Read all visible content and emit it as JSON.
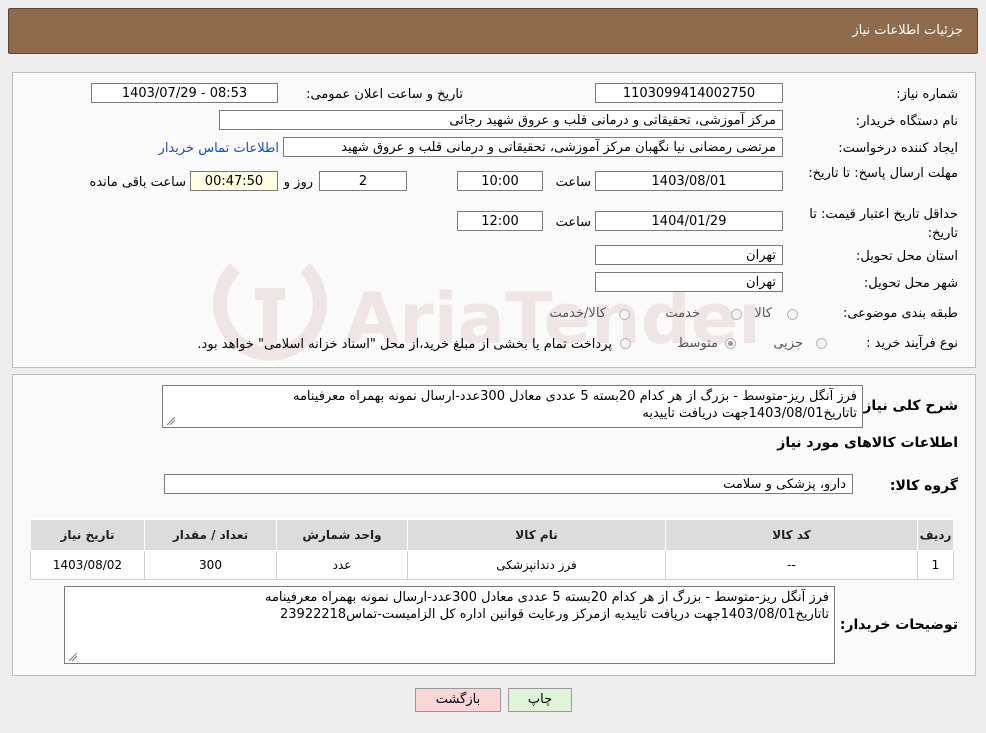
{
  "header": {
    "title": "جزئیات اطلاعات نیاز"
  },
  "info": {
    "need_number_label": "شماره نیاز:",
    "need_number": "1103099414002750",
    "announce_label": "تاریخ و ساعت اعلان عمومی:",
    "announce_value": "1403/07/29 - 08:53",
    "buyer_org_label": "نام دستگاه خریدار:",
    "buyer_org": "مرکز آموزشی، تحقیقاتی و درمانی قلب و عروق شهید رجائی",
    "creator_label": "ایجاد کننده درخواست:",
    "creator": "مرتضی رمضانی نیا نگهبان مرکز آموزشی، تحقیقاتی و درمانی قلب و عروق شهید",
    "contact_link": "اطلاعات تماس خریدار",
    "deadline_label": "مهلت ارسال پاسخ: تا تاریخ:",
    "deadline_date": "1403/08/01",
    "deadline_time_label": "ساعت",
    "deadline_time": "10:00",
    "days": "2",
    "days_label": "روز و",
    "remaining": "00:47:50",
    "remaining_label": "ساعت باقی مانده",
    "validity_label": "حداقل تاریخ اعتبار قیمت: تا تاریخ:",
    "validity_date": "1404/01/29",
    "validity_time_label": "ساعت",
    "validity_time": "12:00",
    "province_label": "استان محل تحویل:",
    "province": "تهران",
    "city_label": "شهر محل تحویل:",
    "city": "تهران",
    "category_label": "طبقه بندی موضوعی:",
    "category_options": [
      "کالا",
      "خدمت",
      "کالا/خدمت"
    ],
    "purchase_label": "نوع فرآیند خرید :",
    "purchase_options": [
      "جزیی",
      "متوسط"
    ],
    "purchase_note": "پرداخت تمام یا بخشی از مبلغ خرید،از محل \"اسناد خزانه اسلامی\" خواهد بود."
  },
  "details": {
    "summary_label": "شرح کلی نیاز:",
    "summary_lines": [
      "فرز آنگل ریز-متوسط - بزرگ از هر کدام 20بسته 5 عددی معادل 300عدد-ارسال نمونه بهمراه معرفینامه",
      "تاتاریخ1403/08/01جهت دریافت تاییدیه"
    ],
    "items_heading": "اطلاعات کالاهای مورد نیاز",
    "group_label": "گروه کالا:",
    "group_value": "دارو، پزشکی و سلامت",
    "table": {
      "headers": [
        "ردیف",
        "کد کالا",
        "نام کالا",
        "واحد شمارش",
        "تعداد / مقدار",
        "تاریخ نیاز"
      ],
      "rows": [
        [
          "1",
          "--",
          "فرز دندانپزشکی",
          "عدد",
          "300",
          "1403/08/02"
        ]
      ]
    },
    "buyer_notes_label": "توضیحات خریدار:",
    "buyer_notes_lines": [
      "فرز آنگل ریز-متوسط - بزرگ از هر کدام 20بسته 5 عددی معادل 300عدد-ارسال نمونه بهمراه معرفینامه",
      "تاتاریخ1403/08/01جهت دریافت تاییدیه ازمرکز ورعایت قوانین اداره کل الزامیست-تماس23922218"
    ]
  },
  "buttons": {
    "print": "چاپ",
    "back": "بازگشت"
  },
  "watermark": {
    "text": "AriaTender.neT"
  },
  "colors": {
    "title_bar": "#8f6b4b",
    "link": "#1a4fb5",
    "remaining_bg": "#ffffe3"
  }
}
